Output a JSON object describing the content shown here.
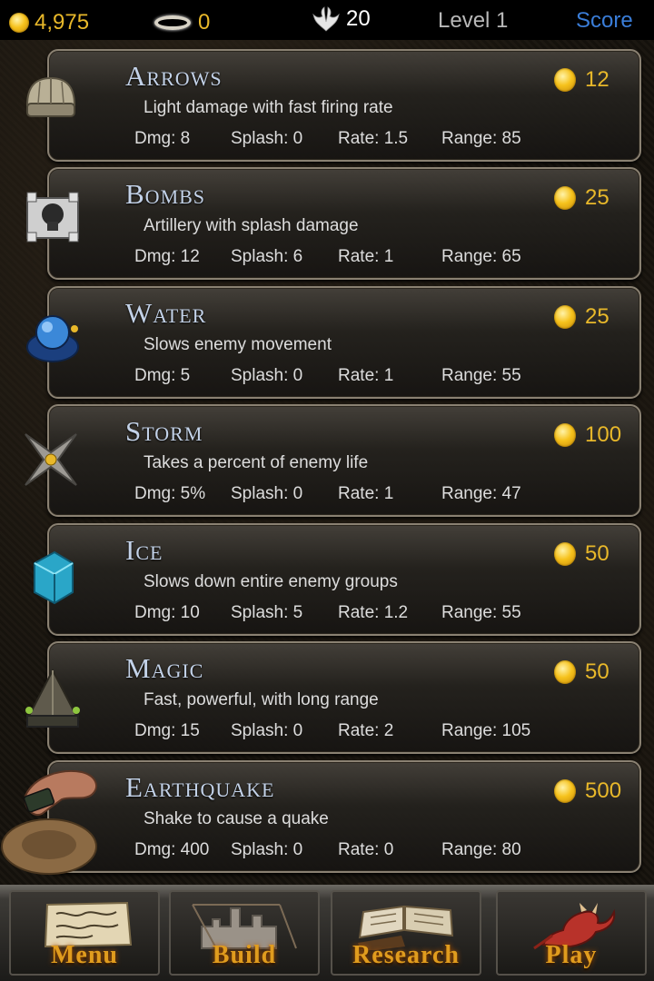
{
  "topbar": {
    "gold": "4,975",
    "halo": "0",
    "lives": "20",
    "level": "Level 1",
    "score_label": "Score"
  },
  "towers": [
    {
      "name": "Arrows",
      "desc": "Light damage with fast firing rate",
      "cost": "12",
      "dmg": "Dmg: 8",
      "splash": "Splash: 0",
      "rate": "Rate: 1.5",
      "range": "Range: 85",
      "icon": "arrow-tower-icon"
    },
    {
      "name": "Bombs",
      "desc": "Artillery with splash damage",
      "cost": "25",
      "dmg": "Dmg: 12",
      "splash": "Splash: 6",
      "rate": "Rate: 1",
      "range": "Range: 65",
      "icon": "bomb-tower-icon"
    },
    {
      "name": "Water",
      "desc": "Slows enemy movement",
      "cost": "25",
      "dmg": "Dmg: 5",
      "splash": "Splash: 0",
      "rate": "Rate: 1",
      "range": "Range: 55",
      "icon": "water-tower-icon"
    },
    {
      "name": "Storm",
      "desc": "Takes a percent of enemy life",
      "cost": "100",
      "dmg": "Dmg: 5%",
      "splash": "Splash: 0",
      "rate": "Rate: 1",
      "range": "Range: 47",
      "icon": "storm-tower-icon"
    },
    {
      "name": "Ice",
      "desc": "Slows down entire enemy groups",
      "cost": "50",
      "dmg": "Dmg: 10",
      "splash": "Splash: 5",
      "rate": "Rate: 1.2",
      "range": "Range: 55",
      "icon": "ice-tower-icon"
    },
    {
      "name": "Magic",
      "desc": "Fast, powerful, with long range",
      "cost": "50",
      "dmg": "Dmg: 15",
      "splash": "Splash: 0",
      "rate": "Rate: 2",
      "range": "Range: 105",
      "icon": "magic-tower-icon"
    },
    {
      "name": "Earthquake",
      "desc": "Shake to cause a quake",
      "cost": "500",
      "dmg": "Dmg: 400",
      "splash": "Splash: 0",
      "rate": "Rate: 0",
      "range": "Range: 80",
      "icon": "earthquake-icon"
    }
  ],
  "nav": {
    "menu": "Menu",
    "build": "Build",
    "research": "Research",
    "play": "Play"
  },
  "colors": {
    "gold_text": "#e8b82a",
    "tower_name": "#c3d2e8",
    "score_link": "#3a7dd8",
    "nav_label": "#e09c1e"
  }
}
